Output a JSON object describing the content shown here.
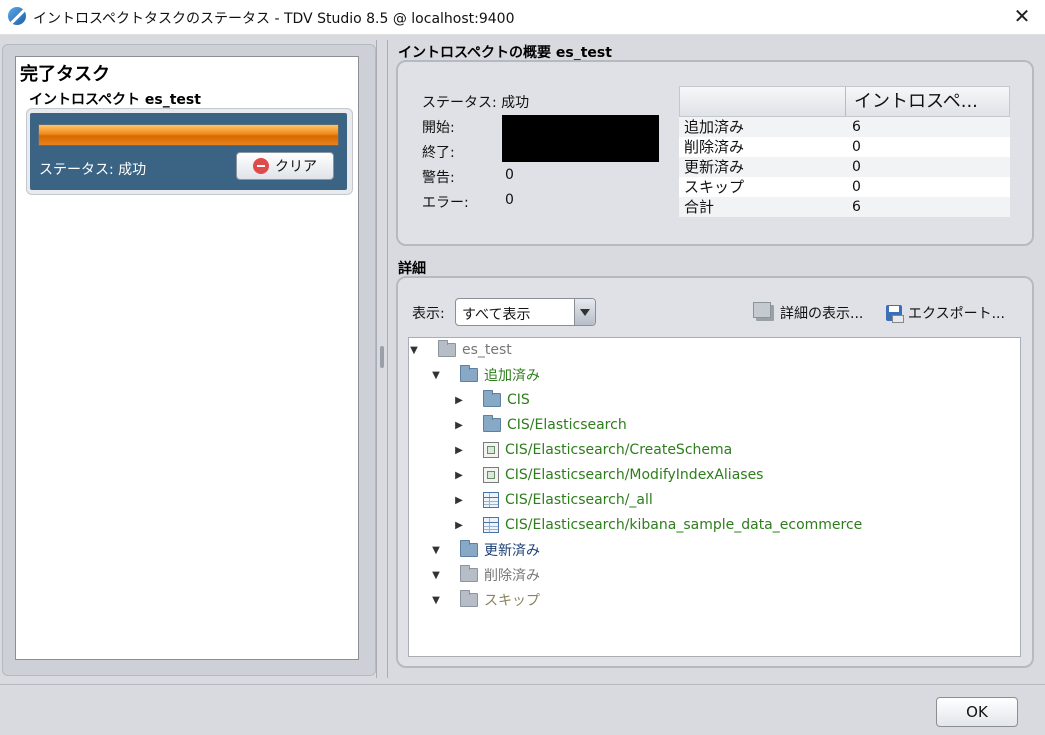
{
  "window": {
    "title": "イントロスペクトタスクのステータス - TDV Studio 8.5 @ localhost:9400",
    "close_glyph": "✕"
  },
  "left_panel": {
    "heading": "完了タスク",
    "task": {
      "name": "イントロスペクト es_test",
      "progress_fraction": 1.0,
      "status": "ステータス: 成功",
      "clear_button": "クリア"
    }
  },
  "summary": {
    "heading": "イントロスペクトの概要  es_test",
    "status": "ステータス: 成功",
    "start_label": "開始:",
    "end_label": "終了:",
    "warning_label": "警告:",
    "warning_value": "0",
    "error_label": "エラー:",
    "error_value": "0",
    "table": {
      "column_header": "イントロスペ...",
      "rows": [
        {
          "label": "追加済み",
          "value": "6"
        },
        {
          "label": "削除済み",
          "value": "0"
        },
        {
          "label": "更新済み",
          "value": "0"
        },
        {
          "label": "スキップ",
          "value": "0"
        },
        {
          "label": "合計",
          "value": "6"
        }
      ]
    }
  },
  "details": {
    "heading": "詳細",
    "show_label": "表示:",
    "show_select_value": "すべて表示",
    "show_details_button": "詳細の表示...",
    "export_button": "エクスポート...",
    "tree": {
      "root": "es_test",
      "added": "追加済み",
      "added_items": [
        "CIS",
        "CIS/Elasticsearch",
        "CIS/Elasticsearch/CreateSchema",
        "CIS/Elasticsearch/ModifyIndexAliases",
        "CIS/Elasticsearch/_all",
        "CIS/Elasticsearch/kibana_sample_data_ecommerce"
      ],
      "updated": "更新済み",
      "deleted": "削除済み",
      "skipped": "スキップ"
    }
  },
  "footer": {
    "ok_button": "OK"
  },
  "colors": {
    "progress": "#f08a1a",
    "task_card": "#3a6384",
    "added_text": "#2e7d1c"
  }
}
